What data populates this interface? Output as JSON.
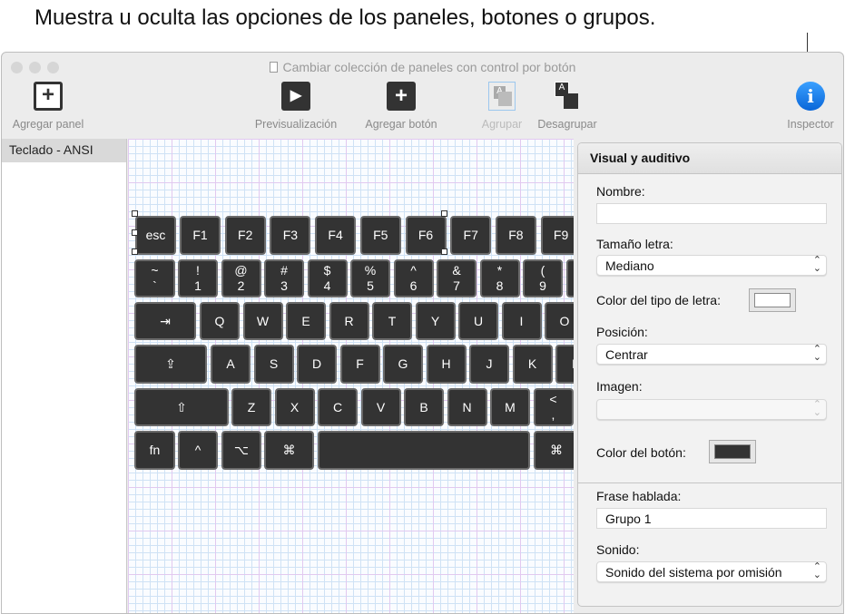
{
  "caption": "Muestra u oculta las opciones de los paneles, botones o grupos.",
  "window": {
    "title": "Cambiar colección de paneles con control por botón"
  },
  "toolbar": {
    "add_panel": "Agregar panel",
    "preview": "Previsualización",
    "add_button": "Agregar botón",
    "group": "Agrupar",
    "ungroup": "Desagrupar",
    "inspector": "Inspector"
  },
  "sidebar": {
    "items": [
      {
        "label": "Teclado - ANSI",
        "selected": true
      }
    ]
  },
  "keyboard": {
    "rows": [
      [
        "esc",
        "F1",
        "F2",
        "F3",
        "F4",
        "F5",
        "F6",
        "F7",
        "F8",
        "F9"
      ],
      [
        "~\n`",
        "!\n1",
        "@\n2",
        "#\n3",
        "$\n4",
        "%\n5",
        "^\n6",
        "&\n7",
        "*\n8",
        "(\n9",
        ""
      ],
      [
        "⇥",
        "Q",
        "W",
        "E",
        "R",
        "T",
        "Y",
        "U",
        "I",
        "O"
      ],
      [
        "⇪",
        "A",
        "S",
        "D",
        "F",
        "G",
        "H",
        "J",
        "K",
        "L"
      ],
      [
        "⇧",
        "Z",
        "X",
        "C",
        "V",
        "B",
        "N",
        "M",
        "<\n,"
      ],
      [
        "fn",
        "^",
        "⌥",
        "⌘",
        "",
        "⌘"
      ]
    ]
  },
  "inspector": {
    "section_title": "Visual y auditivo",
    "name_label": "Nombre:",
    "name_value": "",
    "font_size_label": "Tamaño letra:",
    "font_size_value": "Mediano",
    "font_color_label": "Color del tipo de letra:",
    "font_color": "#ffffff",
    "position_label": "Posición:",
    "position_value": "Centrar",
    "image_label": "Imagen:",
    "image_value": "",
    "button_color_label": "Color del botón:",
    "button_color": "#333333",
    "spoken_label": "Frase hablada:",
    "spoken_value": "Grupo 1",
    "sound_label": "Sonido:",
    "sound_value": "Sonido del sistema por omisión"
  },
  "colors": {
    "inspector_icon": "#1a7cf0",
    "key": "#333333"
  }
}
